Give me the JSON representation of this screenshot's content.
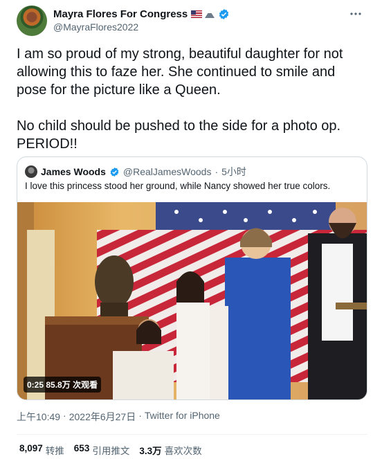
{
  "author": {
    "display_name": "Mayra Flores For Congress",
    "handle": "@MayraFlores2022"
  },
  "tweet": {
    "text": "I am so proud of my strong, beautiful daughter for not allowing this to faze her. She continued to smile and pose for the picture like a Queen.\n\nNo child should be pushed to the side for a photo op. PERIOD!!"
  },
  "quote": {
    "display_name": "James Woods",
    "handle": "@RealJamesWoods",
    "separator": "·",
    "time": "5小时",
    "text": "I love this princess stood her ground, while Nancy showed her true colors.",
    "video_duration": "0:25",
    "video_views": "85.8万 次观看"
  },
  "meta": {
    "time": "上午10:49",
    "separator1": "·",
    "date": "2022年6月27日",
    "separator2": "·",
    "source": "Twitter for iPhone"
  },
  "stats": [
    {
      "count": "8,097",
      "label": "转推"
    },
    {
      "count": "653",
      "label": "引用推文"
    },
    {
      "count": "3.3万",
      "label": "喜欢次数"
    }
  ],
  "icons": {
    "verified": "verified-badge-icon",
    "more": "more-options-icon",
    "accent": "#1d9bf0"
  }
}
